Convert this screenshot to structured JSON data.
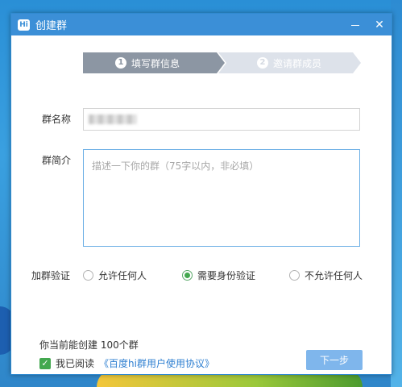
{
  "window": {
    "title": "创建群",
    "app_icon_text": "Hi"
  },
  "steps": [
    {
      "number": "1",
      "label": "填写群信息",
      "active": true,
      "color": "#8c96a3"
    },
    {
      "number": "2",
      "label": "邀请群成员",
      "active": false,
      "color": "#dde2ea"
    }
  ],
  "form": {
    "name_label": "群名称",
    "name_value": "",
    "desc_label": "群简介",
    "desc_placeholder": "描述一下你的群（75字以内，非必填）",
    "verify_label": "加群验证",
    "verify_options": [
      {
        "label": "允许任何人",
        "checked": false
      },
      {
        "label": "需要身份验证",
        "checked": true
      },
      {
        "label": "不允许任何人",
        "checked": false
      }
    ]
  },
  "footer": {
    "quota_text": "你当前能创建 100个群",
    "agree_checked": true,
    "agree_prefix": "我已阅读",
    "agree_link": "《百度hi群用户使用协议》",
    "next_label": "下一步"
  },
  "colors": {
    "titlebar": "#3b8fd7",
    "accent_green": "#43a84f",
    "next_button": "#7fb6ec",
    "link": "#2e7fd1"
  }
}
